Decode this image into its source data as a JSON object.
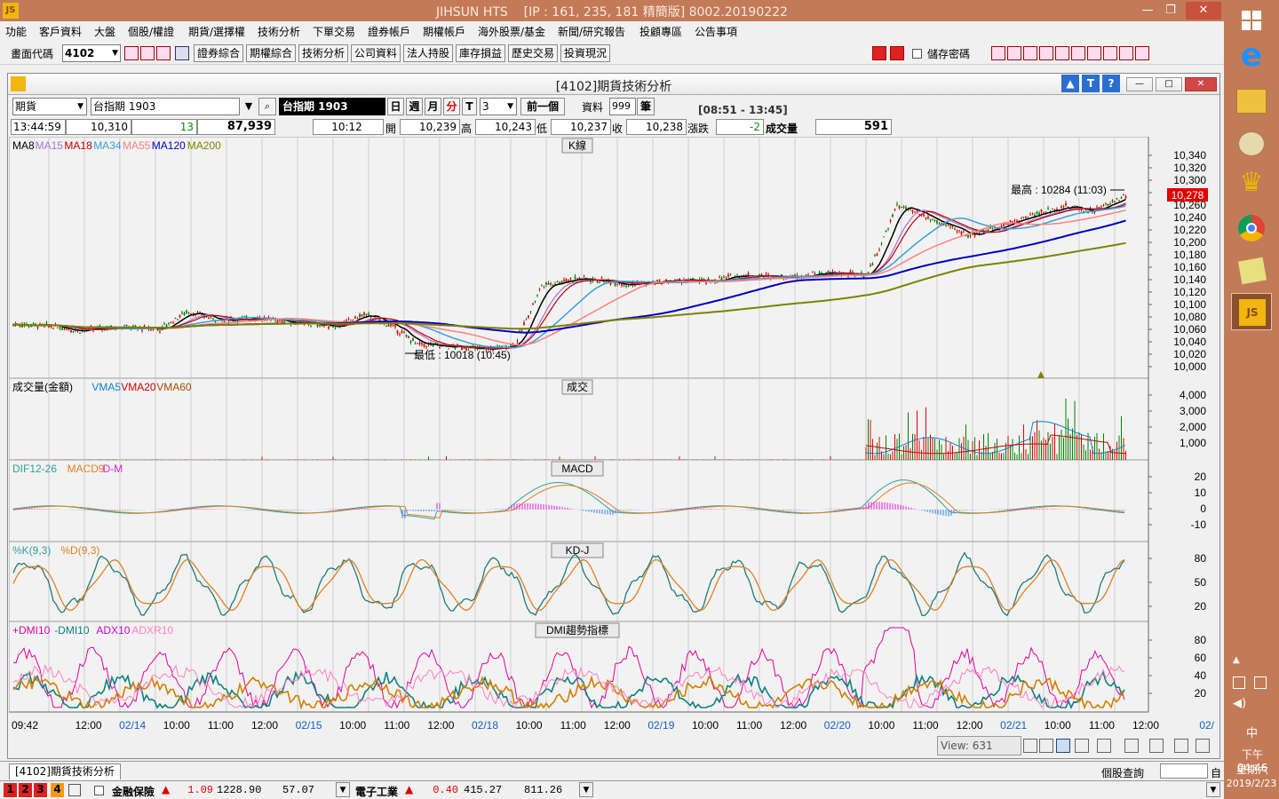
{
  "titlebar": {
    "app": "JIHSUN HTS",
    "info": "[IP : 161, 235, 181 精簡版] 8002.20190222"
  },
  "menu": [
    "功能",
    "客戶資料",
    "大盤",
    "個股/權證",
    "期貨/選擇權",
    "技術分析",
    "下單交易",
    "證券帳戶",
    "期權帳戶",
    "海外股票/基金",
    "新聞/研究報告",
    "投顧專區",
    "公告事項"
  ],
  "toolbar": {
    "code_label": "畫面代碼",
    "code_value": "4102",
    "buttons": [
      "證券綜合",
      "期權綜合",
      "技術分析",
      "公司資料",
      "法人持股",
      "庫存損益",
      "歷史交易",
      "投資現況"
    ],
    "save_pw": "儲存密碼"
  },
  "window": {
    "title": "[4102]期貨技術分析",
    "tab": "[4102]期貨技術分析"
  },
  "controls": {
    "type": "期貨",
    "symbol": "台指期 1903",
    "symbol_name": "台指期 1903",
    "periods": [
      "日",
      "週",
      "月",
      "分",
      "T"
    ],
    "interval": "3",
    "prev": "前一個",
    "data_label": "資料",
    "data_count": "999",
    "unit": "筆",
    "session": "[08:51 - 13:45]"
  },
  "quote": {
    "time": "13:44:59",
    "price": "10,310",
    "arrow": "▼",
    "change": "13",
    "volume": "87,939",
    "bar_time": "10:12",
    "open_label": "開",
    "open": "10,239",
    "high_label": "高",
    "high": "10,243",
    "low_label": "低",
    "low": "10,237",
    "close_label": "收",
    "close": "10,238",
    "chg_label": "漲跌",
    "chg": "-2",
    "vol_label": "成交量",
    "vol": "591"
  },
  "panels": {
    "k": {
      "title": "K線",
      "legend": [
        [
          "MA8",
          "#000000"
        ],
        [
          "MA15",
          "#b070d0"
        ],
        [
          "MA18",
          "#c00000"
        ],
        [
          "MA34",
          "#3a9fd8"
        ],
        [
          "MA55",
          "#ff8080"
        ],
        [
          "MA120",
          "#0000c0"
        ],
        [
          "MA200",
          "#808000"
        ]
      ],
      "high_note": "最高 : 10284 (11:03)",
      "low_note": "最低 : 10018 (10:45)",
      "last": "10,278",
      "yticks": [
        "10,340",
        "10,320",
        "10,300",
        "10,280",
        "10,260",
        "10,240",
        "10,220",
        "10,200",
        "10,180",
        "10,160",
        "10,140",
        "10,120",
        "10,100",
        "10,080",
        "10,060",
        "10,040",
        "10,020",
        "10,000"
      ]
    },
    "vol": {
      "title": "成交",
      "legend": [
        [
          "成交量(金額)",
          "#000000"
        ],
        [
          "VMA5",
          "#1080d0"
        ],
        [
          "VMA20",
          "#d00000"
        ],
        [
          "VMA60",
          "#a05000"
        ]
      ],
      "yticks": [
        "4,000",
        "3,000",
        "2,000",
        "1,000"
      ]
    },
    "macd": {
      "title": "MACD",
      "legend": [
        [
          "DIF12-26",
          "#30a0a0"
        ],
        [
          "MACD9",
          "#e08020"
        ],
        [
          "D-M",
          "#e020e0"
        ]
      ],
      "yticks": [
        "20",
        "10",
        "0",
        "-10"
      ]
    },
    "kd": {
      "title": "KD-J",
      "legend": [
        [
          "%K(9,3)",
          "#30a0a0"
        ],
        [
          "%D(9,3)",
          "#e08020"
        ]
      ],
      "yticks": [
        "80",
        "50",
        "20"
      ]
    },
    "dmi": {
      "title": "DMI趨勢指標",
      "legend": [
        [
          "+DMI10",
          "#e000a0"
        ],
        [
          "-DMI10",
          "#108080"
        ],
        [
          "ADX10",
          "#d000d0"
        ],
        [
          "ADXR10",
          "#ff80c0"
        ]
      ],
      "yticks": [
        "80",
        "60",
        "40",
        "20"
      ]
    }
  },
  "xaxis": [
    [
      "09:42",
      "#000"
    ],
    [
      "12:00",
      "#000"
    ],
    [
      "02/14",
      "#1060c0"
    ],
    [
      "10:00",
      "#000"
    ],
    [
      "11:00",
      "#000"
    ],
    [
      "12:00",
      "#000"
    ],
    [
      "02/15",
      "#1060c0"
    ],
    [
      "10:00",
      "#000"
    ],
    [
      "11:00",
      "#000"
    ],
    [
      "12:00",
      "#000"
    ],
    [
      "02/18",
      "#1060c0"
    ],
    [
      "10:00",
      "#000"
    ],
    [
      "11:00",
      "#000"
    ],
    [
      "12:00",
      "#000"
    ],
    [
      "02/19",
      "#1060c0"
    ],
    [
      "10:00",
      "#000"
    ],
    [
      "11:00",
      "#000"
    ],
    [
      "12:00",
      "#000"
    ],
    [
      "02/20",
      "#1060c0"
    ],
    [
      "10:00",
      "#000"
    ],
    [
      "11:00",
      "#000"
    ],
    [
      "12:00",
      "#000"
    ],
    [
      "02/21",
      "#1060c0"
    ],
    [
      "10:00",
      "#000"
    ],
    [
      "11:00",
      "#000"
    ],
    [
      "12:00",
      "#000"
    ],
    [
      "02/",
      "#1060c0"
    ]
  ],
  "view": {
    "label": "View:",
    "value": "631"
  },
  "bottom": {
    "quote_query": "個股查詢",
    "self": "自",
    "nums": [
      "1",
      "2",
      "3",
      "4"
    ],
    "t1_name": "金融保險",
    "t1_chg": "1.09",
    "t1_idx": "1228.90",
    "t1_val": "57.07",
    "t2_name": "電子工業",
    "t2_chg": "0.40",
    "t2_idx": "415.27",
    "t2_val": "811.26"
  },
  "taskbar": {
    "time": "下午 04:46",
    "weekday": "星期六",
    "date": "2019/2/23",
    "ime": "中"
  }
}
